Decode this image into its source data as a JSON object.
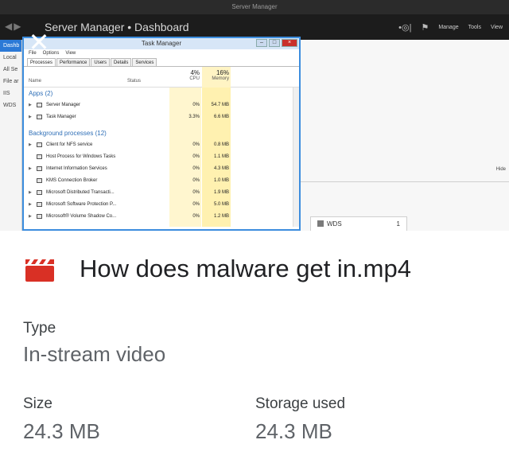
{
  "thumbnail": {
    "window_title": "Server Manager",
    "breadcrumb": "Server Manager • Dashboard",
    "header_actions": [
      "Manage",
      "Tools",
      "View"
    ],
    "sidebar_items": [
      "Dashb",
      "Local",
      "All Se",
      "File ar",
      "IIS",
      "WDS"
    ],
    "hide_label": "Hide",
    "wds_tile": {
      "label": "WDS",
      "count": "1"
    },
    "task_manager": {
      "title": "Task Manager",
      "menu": [
        "File",
        "Options",
        "View"
      ],
      "tabs": [
        "Processes",
        "Performance",
        "Users",
        "Details",
        "Services"
      ],
      "col_name": "Name",
      "col_status": "Status",
      "cpu_pct": "4%",
      "cpu_label": "CPU",
      "mem_pct": "16%",
      "mem_label": "Memory",
      "apps_group": "Apps (2)",
      "bg_group": "Background processes (12)",
      "apps": [
        {
          "name": "Server Manager",
          "cpu": "0%",
          "mem": "54.7 MB"
        },
        {
          "name": "Task Manager",
          "cpu": "3.3%",
          "mem": "6.6 MB"
        }
      ],
      "background": [
        {
          "name": "Client for NFS service",
          "cpu": "0%",
          "mem": "0.8 MB"
        },
        {
          "name": "Host Process for Windows Tasks",
          "cpu": "0%",
          "mem": "1.1 MB"
        },
        {
          "name": "Internet Information Services",
          "cpu": "0%",
          "mem": "4.3 MB"
        },
        {
          "name": "KMS Connection Broker",
          "cpu": "0%",
          "mem": "1.0 MB"
        },
        {
          "name": "Microsoft Distributed Transacti...",
          "cpu": "0%",
          "mem": "1.9 MB"
        },
        {
          "name": "Microsoft Software Protection P...",
          "cpu": "0%",
          "mem": "5.0 MB"
        },
        {
          "name": "Microsoft® Volume Shadow Co...",
          "cpu": "0%",
          "mem": "1.2 MB"
        }
      ]
    }
  },
  "details": {
    "file_name": "How does malware get in.mp4",
    "type_label": "Type",
    "type_value": "In-stream video",
    "size_label": "Size",
    "size_value": "24.3 MB",
    "storage_label": "Storage used",
    "storage_value": "24.3 MB"
  },
  "icons": {
    "close": "close-icon",
    "file": "video-clapperboard-icon",
    "accent": "#d93025"
  }
}
